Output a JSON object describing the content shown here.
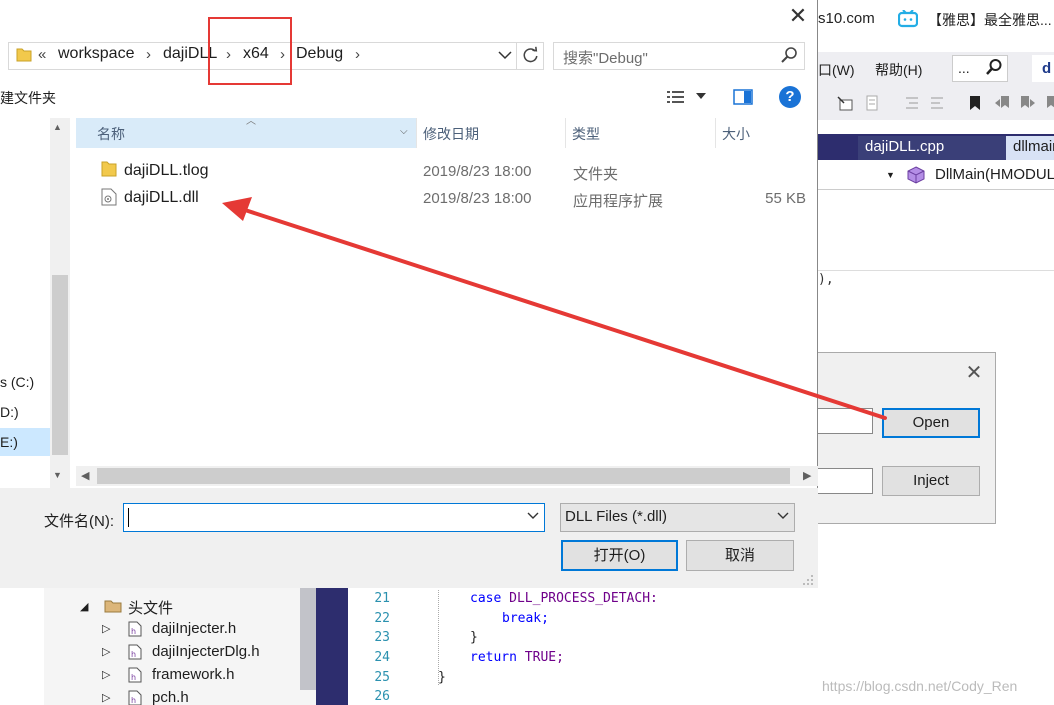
{
  "browser": {
    "url_fragment": "s10.com",
    "tab_title": "【雅思】最全雅思..."
  },
  "vs": {
    "menu_window": "口(W)",
    "menu_help": "帮助(H)",
    "search_text": "...",
    "quick_launch_text": "d",
    "tab_cpp": "dajiDLL.cpp",
    "tab_main": "dllmain",
    "nav_function": "DllMain(HMODULE",
    "editor_fragment": "),",
    "solution_tree": [
      {
        "label": "头文件",
        "icon": "folder-icon",
        "expanded": true
      },
      {
        "label": "dajiInjecter.h",
        "icon": "header-file-icon"
      },
      {
        "label": "dajiInjecterDlg.h",
        "icon": "header-file-icon"
      },
      {
        "label": "framework.h",
        "icon": "header-file-icon"
      },
      {
        "label": "pch.h",
        "icon": "header-file-icon"
      }
    ],
    "code_lines": [
      {
        "num": "21",
        "text": "case DLL_PROCESS_DETACH:"
      },
      {
        "num": "22",
        "text": "break;"
      },
      {
        "num": "23",
        "text": "}"
      },
      {
        "num": "24",
        "text": "return TRUE;"
      },
      {
        "num": "25",
        "text": "}"
      },
      {
        "num": "26",
        "text": ""
      }
    ],
    "watermark": "https://blog.csdn.net/Cody_Ren"
  },
  "inject_dialog": {
    "close_glyph": "✕",
    "open_label": "Open",
    "inject_label": "Inject"
  },
  "file_dialog": {
    "close_glyph": "✕",
    "breadcrumb": {
      "overflow": "«",
      "items": [
        "workspace",
        "dajiDLL",
        "x64",
        "Debug"
      ],
      "sep": "›"
    },
    "search_placeholder": "搜索\"Debug\"",
    "toolbar_new_folder": "建文件夹",
    "help_glyph": "?",
    "columns": {
      "name": "名称",
      "date": "修改日期",
      "type": "类型",
      "size": "大小"
    },
    "files": [
      {
        "name": "dajiDLL.tlog",
        "date": "2019/8/23 18:00",
        "type": "文件夹",
        "size": "",
        "icon": "folder-icon"
      },
      {
        "name": "dajiDLL.dll",
        "date": "2019/8/23 18:00",
        "type": "应用程序扩展",
        "size": "55 KB",
        "icon": "dll-file-icon"
      }
    ],
    "drives": [
      "s (C:)",
      "D:)",
      "E:)"
    ],
    "filename_label": "文件名(N):",
    "filename_value": "",
    "filetype_value": "DLL Files (*.dll)",
    "open_button": "打开(O)",
    "cancel_button": "取消"
  },
  "annotation": {
    "highlight_color": "#e53935",
    "arrow_color": "#e53935"
  }
}
